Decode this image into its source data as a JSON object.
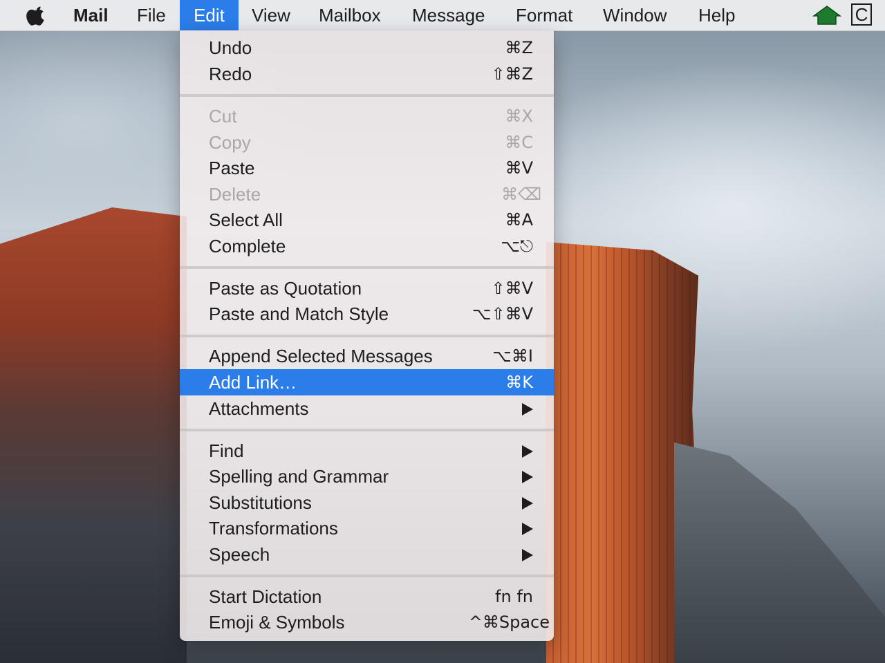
{
  "menubar": {
    "app": "Mail",
    "items": [
      "File",
      "Edit",
      "View",
      "Mailbox",
      "Message",
      "Format",
      "Window",
      "Help"
    ],
    "active": "Edit",
    "status_icons": [
      "apple-icon",
      "home-icon",
      "c-icon"
    ],
    "c_icon_letter": "C"
  },
  "edit_menu": {
    "undo": {
      "label": "Undo",
      "shortcut": "⌘Z"
    },
    "redo": {
      "label": "Redo",
      "shortcut": "⇧⌘Z"
    },
    "cut": {
      "label": "Cut",
      "shortcut": "⌘X",
      "enabled": false
    },
    "copy": {
      "label": "Copy",
      "shortcut": "⌘C",
      "enabled": false
    },
    "paste": {
      "label": "Paste",
      "shortcut": "⌘V"
    },
    "delete": {
      "label": "Delete",
      "shortcut": "⌘⌫",
      "enabled": false
    },
    "select_all": {
      "label": "Select All",
      "shortcut": "⌘A"
    },
    "complete": {
      "label": "Complete",
      "shortcut": "⌥⎋"
    },
    "paste_quotation": {
      "label": "Paste as Quotation",
      "shortcut": "⇧⌘V"
    },
    "paste_match": {
      "label": "Paste and Match Style",
      "shortcut": "⌥⇧⌘V"
    },
    "append": {
      "label": "Append Selected Messages",
      "shortcut": "⌥⌘I"
    },
    "add_link": {
      "label": "Add Link…",
      "shortcut": "⌘K",
      "highlighted": true
    },
    "attachments": {
      "label": "Attachments",
      "submenu": true
    },
    "find": {
      "label": "Find",
      "submenu": true
    },
    "spelling": {
      "label": "Spelling and Grammar",
      "submenu": true
    },
    "substitutions": {
      "label": "Substitutions",
      "submenu": true
    },
    "transformations": {
      "label": "Transformations",
      "submenu": true
    },
    "speech": {
      "label": "Speech",
      "submenu": true
    },
    "dictation": {
      "label": "Start Dictation",
      "shortcut": "fn fn"
    },
    "emoji": {
      "label": "Emoji & Symbols",
      "shortcut": "^⌘Space"
    }
  },
  "colors": {
    "highlight": "#2b7de9",
    "disabled_text": "#a9a6a8",
    "menubar_bg": "#ececee",
    "home_icon": "#1e7a2e"
  }
}
